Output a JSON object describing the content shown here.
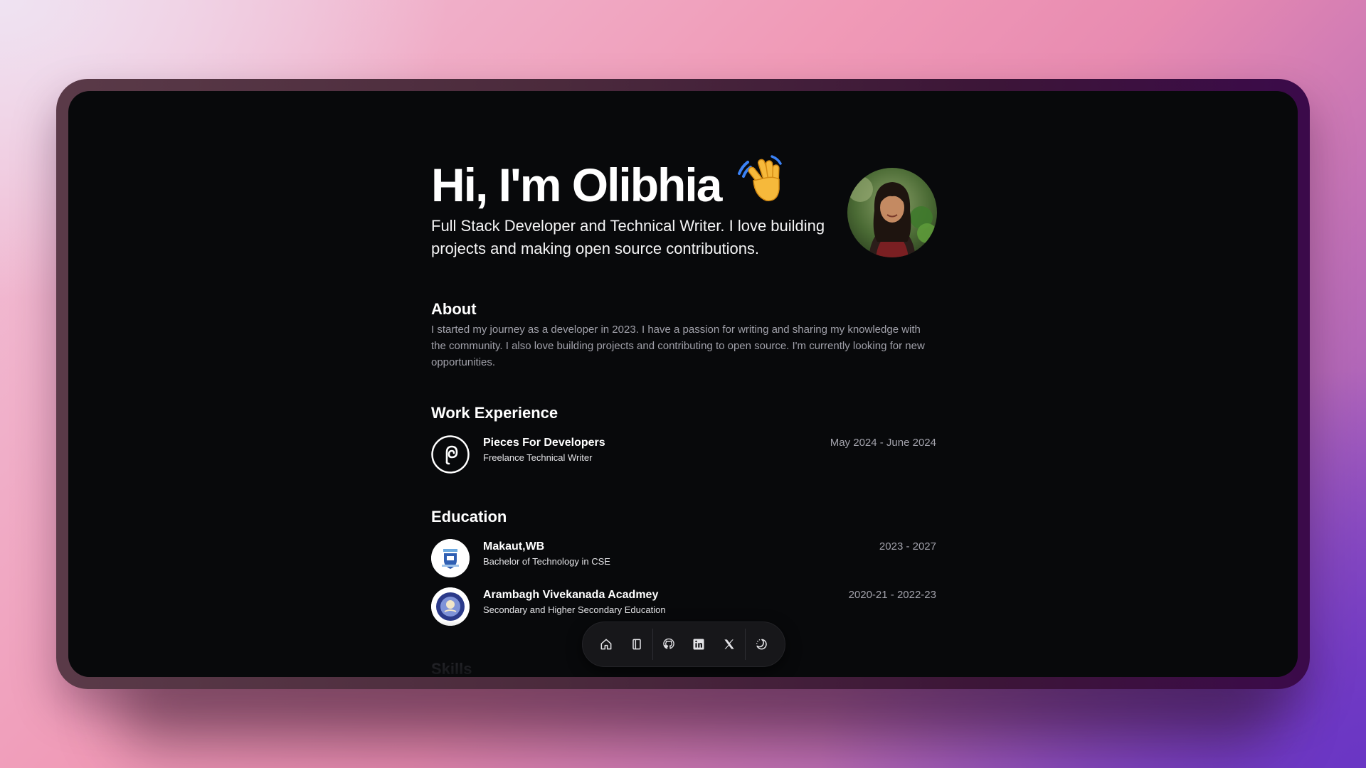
{
  "hero": {
    "greeting": "Hi, I'm Olibhia",
    "tagline": "Full Stack Developer and Technical Writer. I love building projects and making open source contributions."
  },
  "about": {
    "title": "About",
    "text": "I started my journey as a developer in 2023. I have a passion for writing and sharing my knowledge with the community. I also love building projects and contributing to open source. I'm currently looking for new opportunities."
  },
  "work": {
    "title": "Work Experience",
    "items": [
      {
        "name": "Pieces For Developers",
        "role": "Freelance Technical Writer",
        "dates": "May 2024 - June 2024"
      }
    ]
  },
  "education": {
    "title": "Education",
    "items": [
      {
        "name": "Makaut,WB",
        "role": "Bachelor of Technology in CSE",
        "dates": "2023 - 2027"
      },
      {
        "name": "Arambagh Vivekanada Acadmey",
        "role": "Secondary and Higher Secondary Education",
        "dates": "2020-21 - 2022-23"
      }
    ]
  },
  "skills": {
    "title": "Skills"
  },
  "dock": {
    "icons": [
      "home-icon",
      "notebook-icon",
      "github-icon",
      "linkedin-icon",
      "x-icon",
      "theme-toggle-icon"
    ]
  },
  "colors": {
    "screen_bg": "#08090b",
    "muted_text": "#a1a1aa",
    "dock_bg": "#17171a"
  }
}
